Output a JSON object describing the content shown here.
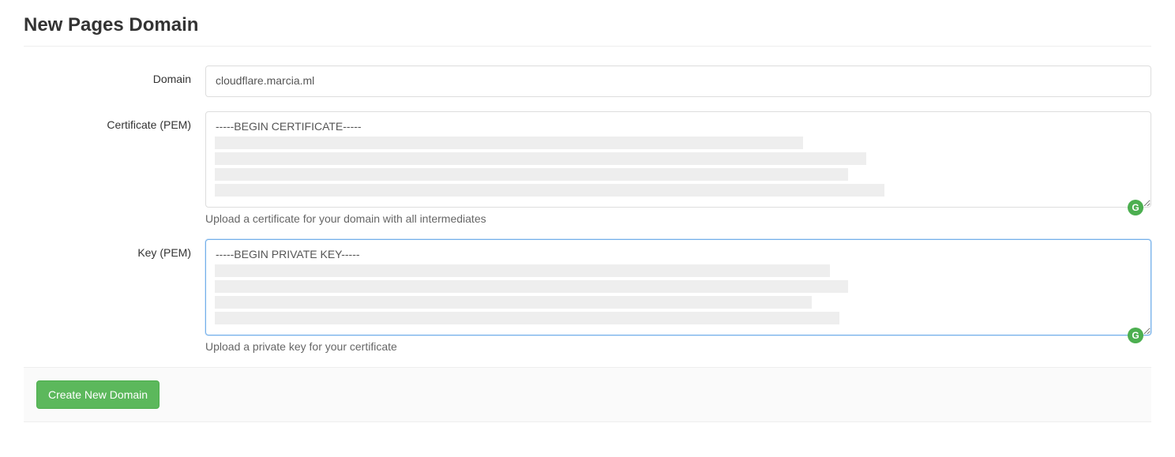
{
  "page": {
    "title": "New Pages Domain"
  },
  "form": {
    "domain": {
      "label": "Domain",
      "value": "cloudflare.marcia.ml"
    },
    "certificate": {
      "label": "Certificate (PEM)",
      "value": "-----BEGIN CERTIFICATE-----",
      "help": "Upload a certificate for your domain with all intermediates"
    },
    "key": {
      "label": "Key (PEM)",
      "value": "-----BEGIN PRIVATE KEY-----",
      "help": "Upload a private key for your certificate"
    }
  },
  "actions": {
    "submit_label": "Create New Domain"
  },
  "badges": {
    "grammarly": "G"
  }
}
